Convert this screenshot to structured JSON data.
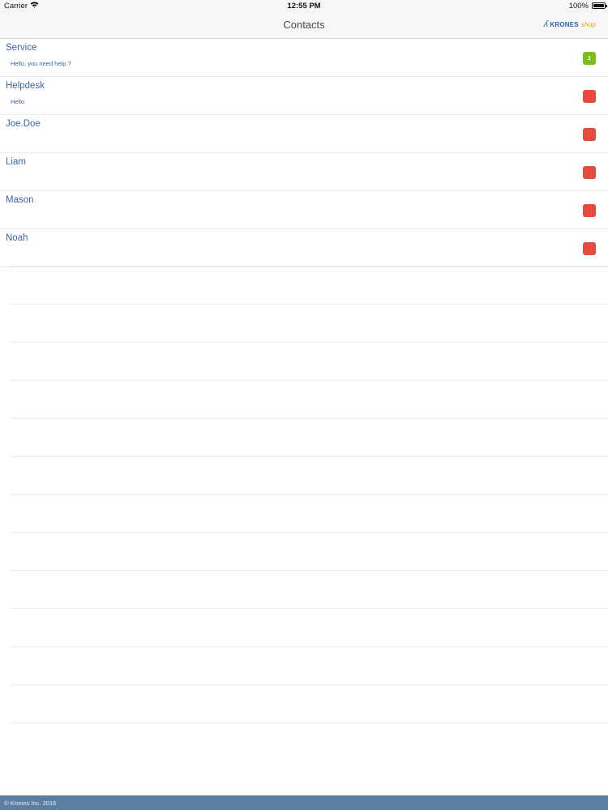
{
  "status_bar": {
    "carrier": "Carrier",
    "time": "12:55 PM",
    "battery": "100%"
  },
  "nav_bar": {
    "title": "Contacts",
    "logo": {
      "brand": "KRONES",
      "suffix": "shop"
    }
  },
  "contacts": [
    {
      "name": "Service",
      "preview": "Hello, you need help ?",
      "badge": "1",
      "status": "green"
    },
    {
      "name": "Helpdesk",
      "preview": "Hello",
      "badge": "",
      "status": "red"
    },
    {
      "name": "Joe.Doe",
      "preview": "",
      "badge": "",
      "status": "red"
    },
    {
      "name": "Liam",
      "preview": "",
      "badge": "",
      "status": "red"
    },
    {
      "name": "Mason",
      "preview": "",
      "badge": "",
      "status": "red"
    },
    {
      "name": "Noah",
      "preview": "",
      "badge": "",
      "status": "red"
    }
  ],
  "footer": {
    "text": "© Krones Inc. 2016"
  },
  "colors": {
    "accent": "#3c63a7",
    "badge_green": "#7bbd1c",
    "badge_red": "#e74b3c",
    "footer_bg": "#5a7fa3"
  }
}
